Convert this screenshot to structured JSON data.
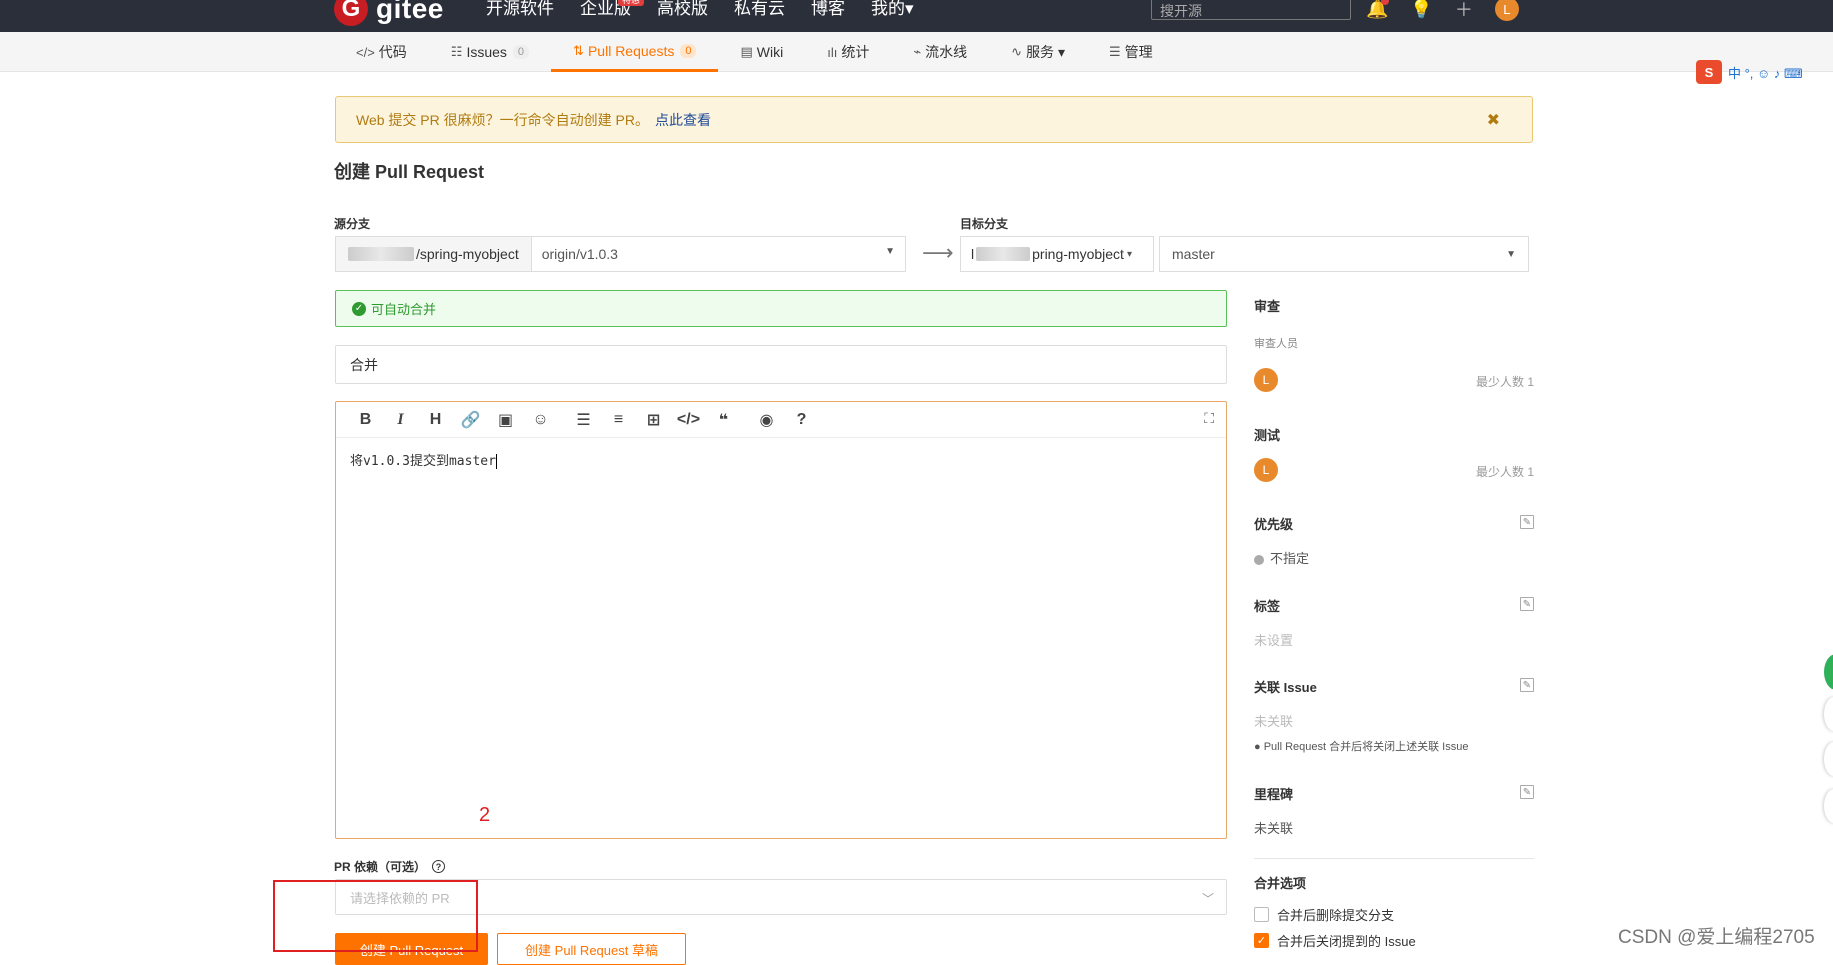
{
  "topbar": {
    "logo_mark": "G",
    "logo_text": "gitee",
    "nav": [
      {
        "label": "开源软件"
      },
      {
        "label": "企业版",
        "badge": "特惠"
      },
      {
        "label": "高校版"
      },
      {
        "label": "私有云"
      },
      {
        "label": "博客"
      },
      {
        "label": "我的▾"
      }
    ],
    "search_placeholder": "搜开源",
    "avatar_initial": "L",
    "icons": [
      "bell-icon",
      "lightbulb-icon",
      "plus-icon",
      "avatar"
    ]
  },
  "subnav": {
    "items": [
      {
        "icon": "</>",
        "label": "代码"
      },
      {
        "icon": "☷",
        "label": "Issues",
        "count": "0"
      },
      {
        "icon": "⇅",
        "label": "Pull Requests",
        "count": "0",
        "active": true
      },
      {
        "icon": "▤",
        "label": "Wiki"
      },
      {
        "icon": "ılı",
        "label": "统计"
      },
      {
        "icon": "⌁",
        "label": "流水线"
      },
      {
        "icon": "∿",
        "label": "服务 ▾"
      },
      {
        "icon": "☰",
        "label": "管理"
      }
    ]
  },
  "ime": {
    "logo": "S",
    "items": "中 °, ☺ ♪ ⌨"
  },
  "notice": {
    "text": "Web 提交 PR 很麻烦？一行命令自动创建 PR。",
    "link": "点此查看",
    "close": "✖"
  },
  "page_title": "创建 Pull Request",
  "source": {
    "label": "源分支",
    "repo": "/spring-myobject",
    "branch": "origin/v1.0.3"
  },
  "target": {
    "label": "目标分支",
    "repo_prefix": "l",
    "repo": "pring-myobject",
    "branch": "master"
  },
  "arrow": "⟶",
  "auto_merge": "可自动合并",
  "title_value": "合并",
  "editor": {
    "toolbar": [
      "B",
      "I",
      "H",
      "🔗",
      "▣",
      "☺",
      "☰",
      "≡",
      "⊞",
      "</>",
      "❝",
      "◉",
      "?"
    ],
    "fullscreen": "⛶",
    "content": "将v1.0.3提交到master"
  },
  "annotation_number": "2",
  "dependency": {
    "label": "PR 依赖（可选）",
    "placeholder": "请选择依赖的 PR"
  },
  "buttons": {
    "create": "创建 Pull Request",
    "draft": "创建 Pull Request 草稿"
  },
  "sidebar": {
    "review_title": "审查",
    "reviewers_label": "审查人员",
    "reviewer_initial": "L",
    "min_count": "最少人数 1",
    "test_title": "测试",
    "tester_initial": "L",
    "test_min_count": "最少人数 1",
    "priority_title": "优先级",
    "priority_value": "不指定",
    "labels_title": "标签",
    "labels_value": "未设置",
    "issue_title": "关联 Issue",
    "issue_value": "未关联",
    "issue_hint": "Pull Request 合并后将关闭上述关联 Issue",
    "milestone_title": "里程碑",
    "milestone_value": "未关联",
    "merge_title": "合并选项",
    "opt_delete_branch": "合并后删除提交分支",
    "opt_close_issue": "合并后关闭提到的 Issue"
  },
  "watermark": "CSDN @爱上编程2705"
}
